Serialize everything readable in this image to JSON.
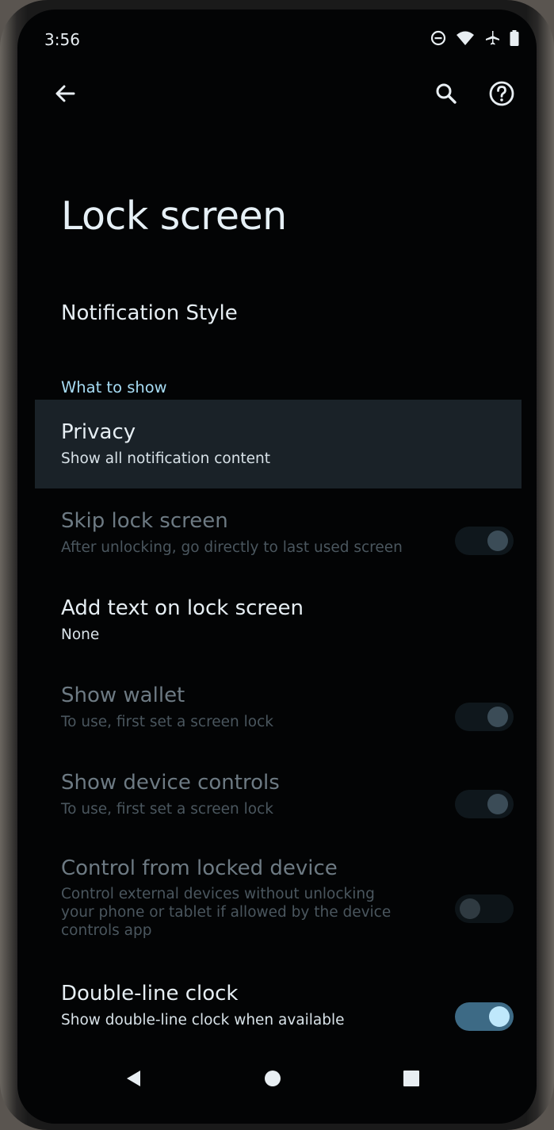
{
  "status_bar": {
    "time": "3:56",
    "icons": [
      "do-not-disturb-icon",
      "wifi-icon",
      "airplane-icon",
      "battery-icon"
    ]
  },
  "toolbar": {
    "back_icon": "back-arrow-icon",
    "search_icon": "search-icon",
    "help_icon": "help-icon"
  },
  "page": {
    "title": "Lock screen"
  },
  "items": {
    "notification_style": {
      "title": "Notification Style"
    },
    "section_header": "What to show",
    "privacy": {
      "title": "Privacy",
      "summary": "Show all notification content"
    },
    "skip_lock_screen": {
      "title": "Skip lock screen",
      "summary": "After unlocking, go directly to last used screen",
      "enabled": false,
      "checked": true
    },
    "add_text": {
      "title": "Add text on lock screen",
      "summary": "None"
    },
    "show_wallet": {
      "title": "Show wallet",
      "summary": "To use, first set a screen lock",
      "enabled": false,
      "checked": true
    },
    "show_device_controls": {
      "title": "Show device controls",
      "summary": "To use, first set a screen lock",
      "enabled": false,
      "checked": true
    },
    "control_from_locked": {
      "title": "Control from locked device",
      "summary": "Control external devices without unlocking your phone or tablet if allowed by the device controls app",
      "enabled": false,
      "checked": false
    },
    "double_line_clock": {
      "title": "Double-line clock",
      "summary": "Show double-line clock when available",
      "enabled": true,
      "checked": true
    }
  },
  "colors": {
    "background": "#030405",
    "accent": "#a7dcf4",
    "selected_row": "#1a2228",
    "switch_on_track": "#3d6a85",
    "switch_on_thumb": "#bfe8fb"
  },
  "nav_bar": {
    "icons": [
      "nav-back-icon",
      "nav-home-icon",
      "nav-recents-icon"
    ]
  }
}
